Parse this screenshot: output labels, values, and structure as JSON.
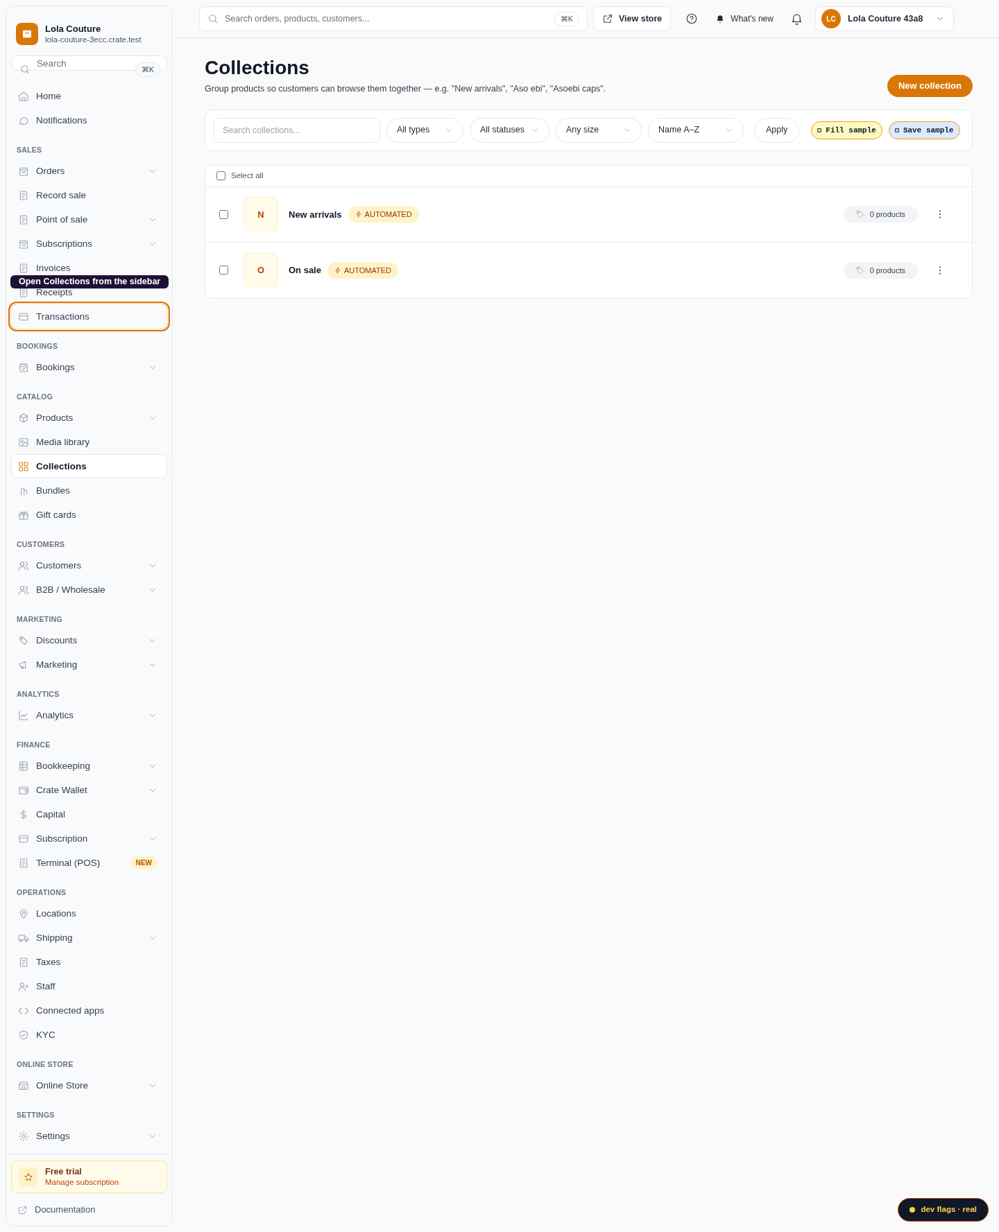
{
  "store": {
    "name": "Lola Couture",
    "domain": "lola-couture-3ecc.crate.test"
  },
  "sidebar_search": {
    "placeholder": "Search",
    "shortcut": "⌘K"
  },
  "sidebar": {
    "sections": [
      {
        "items": [
          {
            "label": "Home",
            "expandable": false,
            "selected": false,
            "highlighted": false
          },
          {
            "label": "Notifications",
            "expandable": false,
            "selected": false,
            "highlighted": false
          }
        ]
      },
      {
        "title": "SALES",
        "items": [
          {
            "label": "Orders",
            "expandable": true,
            "selected": false,
            "highlighted": false
          },
          {
            "label": "Record sale",
            "expandable": false,
            "selected": false,
            "highlighted": false
          },
          {
            "label": "Point of sale",
            "expandable": true,
            "selected": false,
            "highlighted": false
          },
          {
            "label": "Subscriptions",
            "expandable": true,
            "selected": false,
            "highlighted": false
          },
          {
            "label": "Invoices",
            "expandable": false,
            "selected": false,
            "highlighted": false
          },
          {
            "label": "Receipts",
            "expandable": false,
            "selected": false,
            "highlighted": false
          },
          {
            "label": "Transactions",
            "expandable": false,
            "selected": false,
            "highlighted": true
          }
        ]
      },
      {
        "title": "BOOKINGS",
        "items": [
          {
            "label": "Bookings",
            "expandable": true,
            "selected": false,
            "highlighted": false
          }
        ]
      },
      {
        "title": "CATALOG",
        "items": [
          {
            "label": "Products",
            "expandable": true,
            "selected": false,
            "highlighted": false
          },
          {
            "label": "Media library",
            "expandable": false,
            "selected": false,
            "highlighted": false
          },
          {
            "label": "Collections",
            "expandable": false,
            "selected": true,
            "highlighted": false
          },
          {
            "label": "Bundles",
            "expandable": false,
            "selected": false,
            "highlighted": false
          },
          {
            "label": "Gift cards",
            "expandable": false,
            "selected": false,
            "highlighted": false
          }
        ]
      },
      {
        "title": "CUSTOMERS",
        "items": [
          {
            "label": "Customers",
            "expandable": true,
            "selected": false,
            "highlighted": false
          },
          {
            "label": "B2B / Wholesale",
            "expandable": true,
            "selected": false,
            "highlighted": false
          }
        ]
      },
      {
        "title": "MARKETING",
        "items": [
          {
            "label": "Discounts",
            "expandable": true,
            "selected": false,
            "highlighted": false
          },
          {
            "label": "Marketing",
            "expandable": true,
            "selected": false,
            "highlighted": false
          }
        ]
      },
      {
        "title": "ANALYTICS",
        "items": [
          {
            "label": "Analytics",
            "expandable": true,
            "selected": false,
            "highlighted": false
          }
        ]
      },
      {
        "title": "FINANCE",
        "items": [
          {
            "label": "Bookkeeping",
            "expandable": true,
            "selected": false,
            "highlighted": false
          },
          {
            "label": "Crate Wallet",
            "expandable": true,
            "selected": false,
            "highlighted": false
          },
          {
            "label": "Capital",
            "expandable": false,
            "selected": false,
            "highlighted": false
          },
          {
            "label": "Subscription",
            "expandable": true,
            "selected": false,
            "highlighted": false
          },
          {
            "label": "Terminal (POS)",
            "expandable": false,
            "selected": false,
            "highlighted": false,
            "badge": "NEW"
          }
        ]
      },
      {
        "title": "OPERATIONS",
        "items": [
          {
            "label": "Locations",
            "expandable": false,
            "selected": false,
            "highlighted": false
          },
          {
            "label": "Shipping",
            "expandable": true,
            "selected": false,
            "highlighted": false
          },
          {
            "label": "Taxes",
            "expandable": false,
            "selected": false,
            "highlighted": false
          },
          {
            "label": "Staff",
            "expandable": false,
            "selected": false,
            "highlighted": false
          },
          {
            "label": "Connected apps",
            "expandable": false,
            "selected": false,
            "highlighted": false
          },
          {
            "label": "KYC",
            "expandable": false,
            "selected": false,
            "highlighted": false
          }
        ]
      },
      {
        "title": "ONLINE STORE",
        "items": [
          {
            "label": "Online Store",
            "expandable": true,
            "selected": false,
            "highlighted": false
          }
        ]
      },
      {
        "title": "SETTINGS",
        "items": [
          {
            "label": "Settings",
            "expandable": true,
            "selected": false,
            "highlighted": false
          }
        ]
      }
    ]
  },
  "tour_tooltip": "Open Collections from the sidebar",
  "trial": {
    "title": "Free trial",
    "subtitle": "Manage subscription"
  },
  "documentation": "Documentation",
  "topbar": {
    "search_placeholder": "Search orders, products, customers...",
    "shortcut": "⌘K",
    "view_store": "View store",
    "whats_new": "What's new",
    "account": {
      "initials": "LC",
      "name": "Lola Couture 43a8"
    }
  },
  "page": {
    "title": "Collections",
    "subtitle": "Group products so customers can browse them together — e.g. \"New arrivals\", \"Aso ebi\", \"Asoebi caps\".",
    "primary_button": "New collection"
  },
  "filters": {
    "search_placeholder": "Search collections...",
    "selects": [
      "All types",
      "All statuses",
      "Any size",
      "Name A–Z"
    ],
    "apply": "Apply",
    "sample_buttons": [
      {
        "kind": "fill",
        "label": "Fill sample"
      },
      {
        "kind": "save",
        "label": "Save sample"
      }
    ]
  },
  "list": {
    "select_all": {
      "label": "Select all",
      "checked": false
    },
    "rows": [
      {
        "initial": "N",
        "name": "New arrivals",
        "badge": "AUTOMATED",
        "count": "0 products",
        "checked": false
      },
      {
        "initial": "O",
        "name": "On sale",
        "badge": "AUTOMATED",
        "count": "0 products",
        "checked": false
      }
    ]
  },
  "dev_flags": "dev flags · real"
}
